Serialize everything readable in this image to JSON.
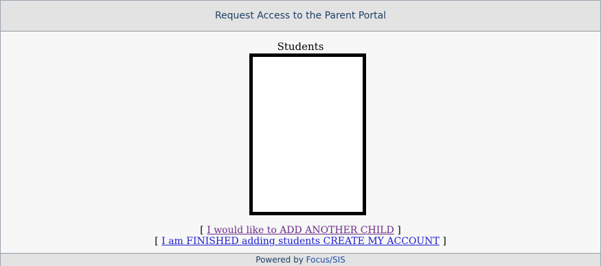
{
  "header": {
    "title": "Request Access to the Parent Portal"
  },
  "students": {
    "label": "Students"
  },
  "actions": {
    "add_child_prefix": "[ ",
    "add_child_label": "I would like to ADD ANOTHER CHILD",
    "add_child_suffix": " ]",
    "finish_prefix": "[ ",
    "finish_label": "I am FINISHED adding students CREATE MY ACCOUNT",
    "finish_suffix": " ]"
  },
  "footer": {
    "prefix": "Powered by ",
    "link_label": "Focus/SIS"
  }
}
